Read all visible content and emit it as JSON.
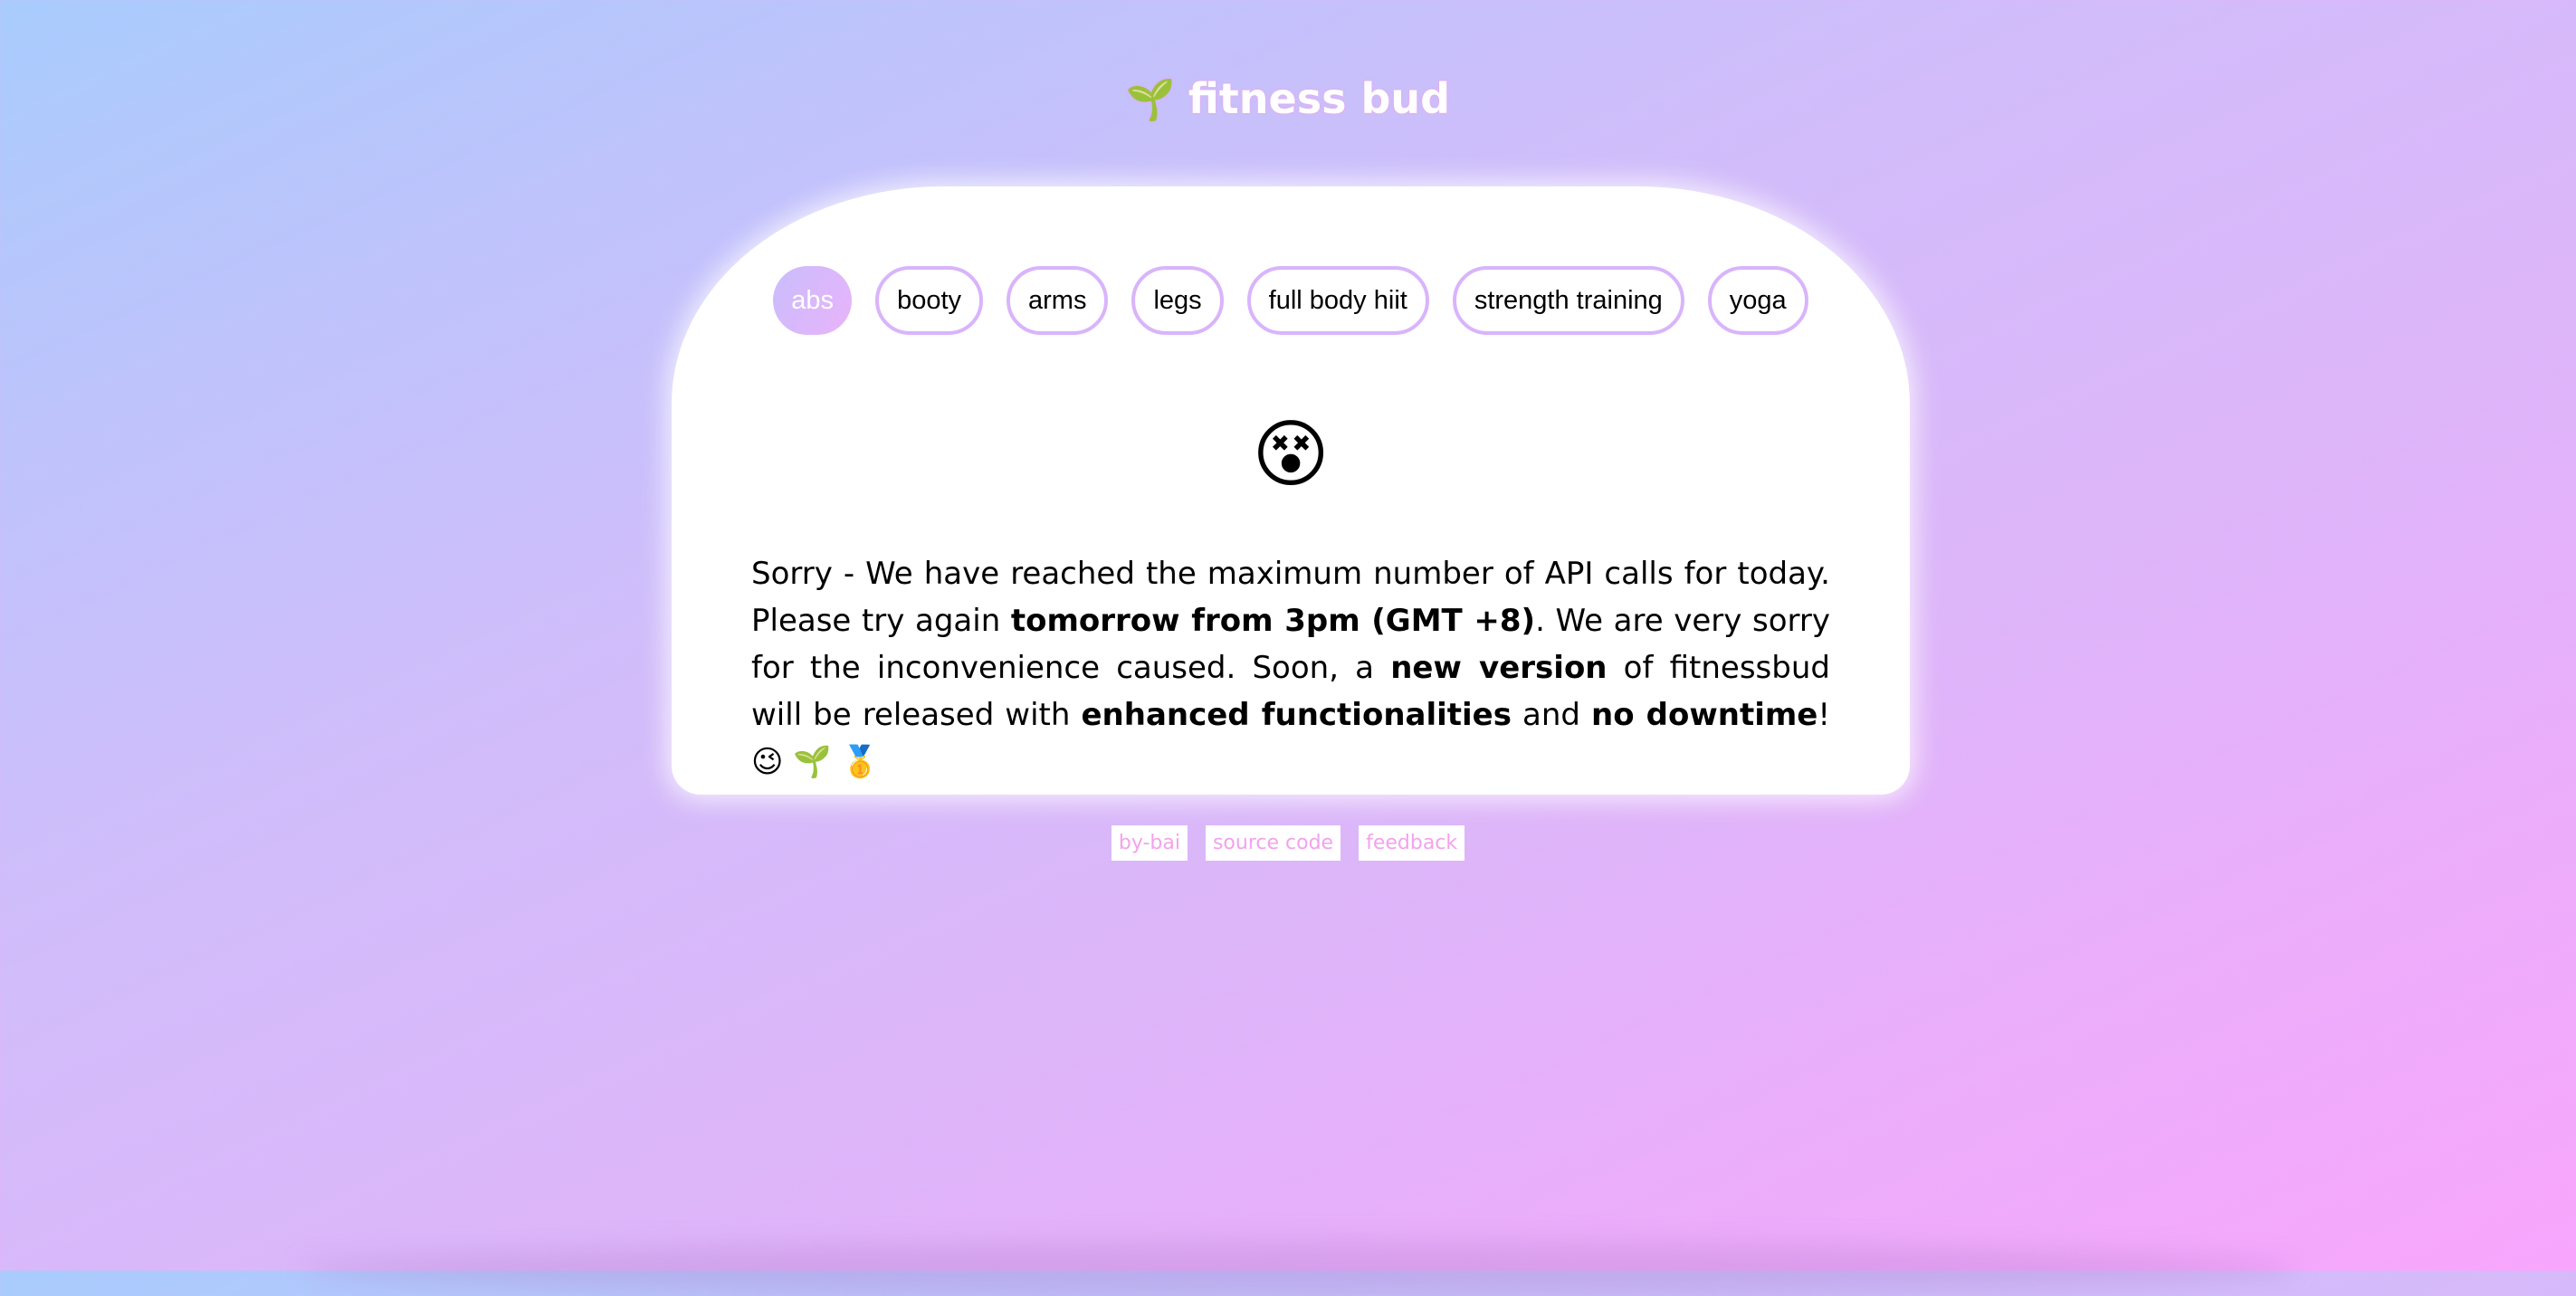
{
  "header": {
    "logo_icon": "🌱",
    "title": "fitness bud"
  },
  "tabs": [
    {
      "label": "abs",
      "active": true
    },
    {
      "label": "booty",
      "active": false
    },
    {
      "label": "arms",
      "active": false
    },
    {
      "label": "legs",
      "active": false
    },
    {
      "label": "full body hiit",
      "active": false
    },
    {
      "label": "strength training",
      "active": false
    },
    {
      "label": "yoga",
      "active": false
    }
  ],
  "status": {
    "icon": "😵",
    "message_parts": {
      "p1": "Sorry - We have reached the maximum number of API calls for today. Please try again ",
      "b1": "tomorrow from 3pm (GMT +8)",
      "p2": ". We are very sorry for the inconvenience caused. Soon, a ",
      "b2": "new version",
      "p3": " of fitnessbud will be released with ",
      "b3": "enhanced functionalities",
      "p4": " and ",
      "b4": "no downtime",
      "p5": "! 😉 🌱 🥇"
    }
  },
  "footer": {
    "links": [
      "by-bai",
      "source code",
      "feedback"
    ]
  },
  "colors": {
    "accent": "#e9b3fb",
    "tab_border": "#d9b4fb",
    "footer_text": "#f3a2ec"
  }
}
